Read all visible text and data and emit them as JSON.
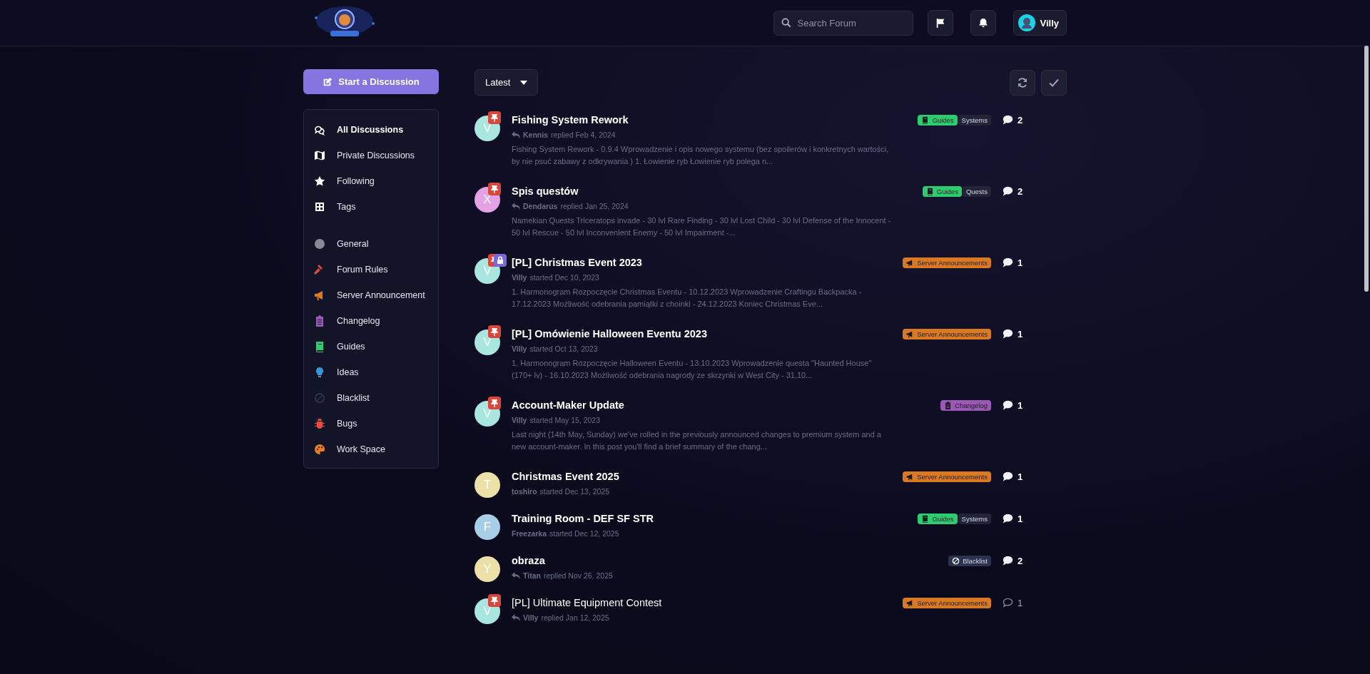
{
  "header": {
    "search": {
      "placeholder": "Search Forum"
    },
    "user": {
      "name": "Villy"
    }
  },
  "sidebar": {
    "start_button": "Start a Discussion",
    "items": [
      {
        "label": "All Discussions",
        "kind": "comments",
        "selected": true
      },
      {
        "label": "Private Discussions",
        "kind": "map",
        "selected": false
      },
      {
        "label": "Following",
        "kind": "star",
        "selected": false
      },
      {
        "label": "Tags",
        "kind": "grid",
        "selected": false
      }
    ],
    "tags": [
      {
        "label": "General",
        "kind": "circle",
        "color": "#8a8a95",
        "selected": false
      },
      {
        "label": "Forum Rules",
        "kind": "gavel",
        "color": "#d94a3a",
        "selected": false
      },
      {
        "label": "Server Announcement",
        "kind": "megaphone",
        "color": "#e0781f",
        "selected": false
      },
      {
        "label": "Changelog",
        "kind": "clipboard",
        "color": "#9b59b6",
        "selected": false
      },
      {
        "label": "Guides",
        "kind": "book",
        "color": "#2ecc71",
        "selected": false
      },
      {
        "label": "Ideas",
        "kind": "bulb",
        "color": "#3498db",
        "selected": false
      },
      {
        "label": "Blacklist",
        "kind": "ban",
        "color": "#2c3350",
        "selected": false
      },
      {
        "label": "Bugs",
        "kind": "bug",
        "color": "#e74c3c",
        "selected": false
      },
      {
        "label": "Work Space",
        "kind": "palette",
        "color": "#e67e22",
        "selected": false
      }
    ]
  },
  "toolbar": {
    "sort": "Latest"
  },
  "discussions": [
    {
      "title": "Fishing System Rework",
      "avatar": {
        "letter": "V",
        "color": "#a8e6df"
      },
      "pinned": true,
      "locked": false,
      "unread": true,
      "replied": true,
      "user": "Kennis",
      "action": "replied",
      "date": "Feb 4, 2024",
      "excerpt": "Fishing System Rework - 0.9.4 Wprowadzenie i opis nowego systemu (bez spoilerów i konkretnych wartości, by nie psuć zabawy z odkrywania ) 1. Łowienie ryb Łowienie ryb polega n...",
      "tags": [
        {
          "label": "Guides",
          "kind": "book",
          "color": "#2ecc71"
        },
        {
          "label": "Systems",
          "color": "#22243a"
        }
      ],
      "comments": "2"
    },
    {
      "title": "Spis questów",
      "avatar": {
        "letter": "X",
        "color": "#e3a3e6"
      },
      "pinned": true,
      "locked": false,
      "unread": true,
      "replied": true,
      "user": "Dendarus",
      "action": "replied",
      "date": "Jan 25, 2024",
      "excerpt": "Namekian Quests Triceratops invade - 30 lvl Rare Finding - 30 lvl Lost Child - 30 lvl Defense of the Innocent - 50 lvl Rescue - 50 lvl Inconvenient Enemy - 50 lvl Impairment -...",
      "tags": [
        {
          "label": "Guides",
          "kind": "book",
          "color": "#2ecc71"
        },
        {
          "label": "Quests",
          "color": "#22243a"
        }
      ],
      "comments": "2"
    },
    {
      "title": "[PL] Christmas Event 2023",
      "avatar": {
        "letter": "V",
        "color": "#a8e6df"
      },
      "pinned": true,
      "locked": true,
      "unread": true,
      "replied": false,
      "user": "Villy",
      "action": "started",
      "date": "Dec 10, 2023",
      "excerpt": "1. Harmonogram Rozpoczęcie Christmas Eventu - 10.12.2023 Wprowadzenie Craftingu Backpacka - 17.12.2023 Możliwość odebrania pamiątki z choinki - 24.12.2023 Koniec Christmas Eve...",
      "tags": [
        {
          "label": "Server Announcements",
          "kind": "megaphone",
          "color": "#d97a22"
        }
      ],
      "comments": "1"
    },
    {
      "title": "[PL] Omówienie Halloween Eventu 2023",
      "avatar": {
        "letter": "V",
        "color": "#a8e6df"
      },
      "pinned": true,
      "locked": false,
      "unread": true,
      "replied": false,
      "user": "Villy",
      "action": "started",
      "date": "Oct 13, 2023",
      "excerpt": "1. Harmonogram Rozpoczęcie Halloween Eventu - 13.10.2023 Wprowadzenie questa \"Haunted House\" (170+ lv) - 16.10.2023 Możliwość odebrania nagrody ze skrzynki w West City - 31.10...",
      "tags": [
        {
          "label": "Server Announcements",
          "kind": "megaphone",
          "color": "#d97a22"
        }
      ],
      "comments": "1"
    },
    {
      "title": "Account-Maker Update",
      "avatar": {
        "letter": "V",
        "color": "#a8e6df"
      },
      "pinned": true,
      "locked": false,
      "unread": true,
      "replied": false,
      "user": "Villy",
      "action": "started",
      "date": "May 15, 2023",
      "excerpt": "Last night (14th May, Sunday) we've rolled in the previously announced changes to premium system and a new account-maker. In this post you'll find a brief summary of the chang...",
      "tags": [
        {
          "label": "Changelog",
          "kind": "clipboard",
          "color": "#9b59b6"
        }
      ],
      "comments": "1"
    },
    {
      "title": "Christmas Event 2025",
      "avatar": {
        "letter": "T",
        "color": "#ebe0a8"
      },
      "pinned": false,
      "locked": false,
      "unread": true,
      "replied": false,
      "user": "toshiro",
      "action": "started",
      "date": "Dec 13, 2025",
      "tags": [
        {
          "label": "Server Announcements",
          "kind": "megaphone",
          "color": "#d97a22"
        }
      ],
      "comments": "1"
    },
    {
      "title": "Training Room - DEF SF STR",
      "avatar": {
        "letter": "F",
        "color": "#a8cde6"
      },
      "pinned": false,
      "locked": false,
      "unread": true,
      "replied": false,
      "user": "Freezarka",
      "action": "started",
      "date": "Dec 12, 2025",
      "tags": [
        {
          "label": "Guides",
          "kind": "book",
          "color": "#2ecc71"
        },
        {
          "label": "Systems",
          "color": "#22243a"
        }
      ],
      "comments": "1"
    },
    {
      "title": "obraza",
      "avatar": {
        "letter": "Y",
        "color": "#ebe0a8"
      },
      "pinned": false,
      "locked": false,
      "unread": true,
      "replied": true,
      "user": "Titan",
      "action": "replied",
      "date": "Nov 26, 2025",
      "tags": [
        {
          "label": "Blacklist",
          "kind": "ban",
          "color": "#2c3350"
        }
      ],
      "comments": "2"
    },
    {
      "title": "[PL] Ultimate Equipment Contest",
      "avatar": {
        "letter": "V",
        "color": "#a8e6df"
      },
      "pinned": true,
      "locked": false,
      "unread": false,
      "replied": true,
      "user": "Villy",
      "action": "replied",
      "date": "Jan 12, 2025",
      "tags": [
        {
          "label": "Server Announcements",
          "kind": "megaphone",
          "color": "#d97a22"
        }
      ],
      "comments": "1"
    }
  ]
}
